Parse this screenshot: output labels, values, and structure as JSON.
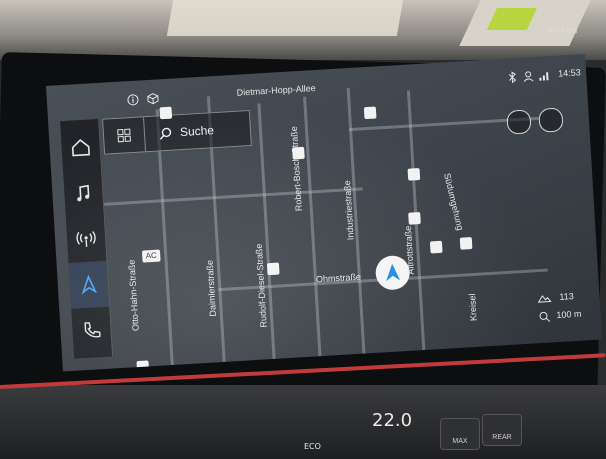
{
  "status_bar": {
    "street": "Dietmar-Hopp-Allee",
    "time": "14:53"
  },
  "nav": {
    "search_label": "Suche"
  },
  "streets": [
    {
      "name": "Otto-Hahn-Straße"
    },
    {
      "name": "Daimlerstraße"
    },
    {
      "name": "Rudolf-Diesel-Straße"
    },
    {
      "name": "Robert-Bosch-Straße"
    },
    {
      "name": "Industriestraße"
    },
    {
      "name": "Altrottstraße"
    },
    {
      "name": "Ohmstraße"
    },
    {
      "name": "Südumgehung"
    },
    {
      "name": "Kreisel"
    }
  ],
  "poi": {
    "ac_label": "AC"
  },
  "scale": {
    "value": "113",
    "unit": "100 m"
  },
  "climate": {
    "temperature": "22.0",
    "eco_label": "ECO",
    "max_label": "MAX",
    "rear_label": "REAR"
  },
  "colors": {
    "accent": "#1e88e5",
    "screen": "#3d434a",
    "trim": "#c23a3a"
  }
}
